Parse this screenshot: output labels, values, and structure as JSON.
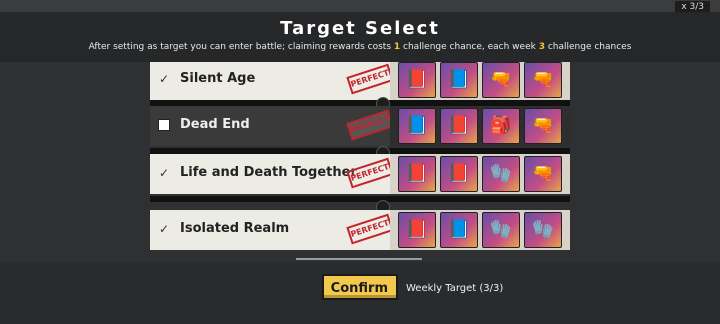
{
  "background": {
    "left_text": "",
    "right_text": "x 3/3"
  },
  "header": {
    "title": "Target Select",
    "subtitle_before": "After setting as target you can enter battle; claiming rewards costs ",
    "subtitle_num1": "1",
    "subtitle_middle": " challenge chance, each week ",
    "subtitle_num2": "3",
    "subtitle_after": " challenge chances"
  },
  "rows": [
    {
      "name": "Silent Age",
      "checked": true,
      "stamp": "PERFECT",
      "items": [
        "📕",
        "📘",
        "🔫",
        "🔫"
      ]
    },
    {
      "name": "Dead End",
      "checked": false,
      "stamp": "PERFECT",
      "items": [
        "📘",
        "📕",
        "🎒",
        "🔫"
      ]
    },
    {
      "name": "Life and Death Together",
      "checked": true,
      "stamp": "PERFECT",
      "items": [
        "📕",
        "📕",
        "🧤",
        "🔫"
      ]
    },
    {
      "name": "Isolated Realm",
      "checked": true,
      "stamp": "PERFECT",
      "items": [
        "📕",
        "📘",
        "🧤",
        "🧤"
      ]
    }
  ],
  "footer": {
    "confirm_label": "Confirm",
    "weekly_label": "Weekly Target (3/3)"
  }
}
